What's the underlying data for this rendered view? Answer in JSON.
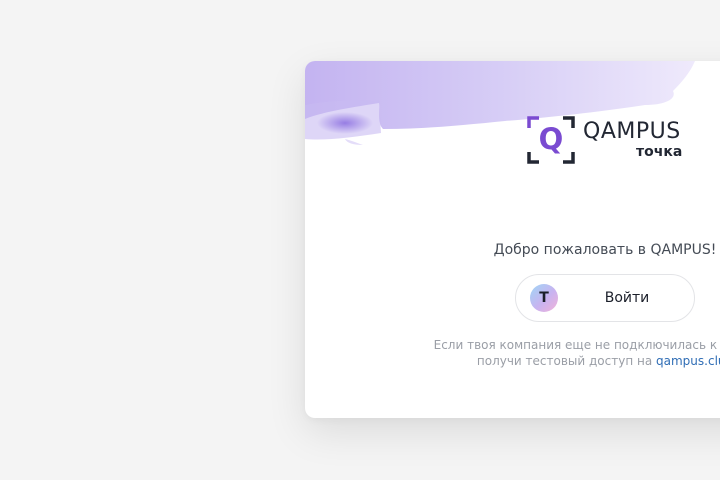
{
  "logo": {
    "mark_letter": "Q",
    "name": "QAMPUS",
    "sub": "точка",
    "accent_color": "#7a4bd1"
  },
  "welcome": "Добро пожаловать в QAMPUS!",
  "login_button": {
    "icon_letter": "T",
    "label": "Войти"
  },
  "hint": {
    "line1": "Если твоя компания еще не подключилась к QAMPUS,",
    "line2_prefix": "получи тестовый доступ на ",
    "link": "qampus.club"
  }
}
